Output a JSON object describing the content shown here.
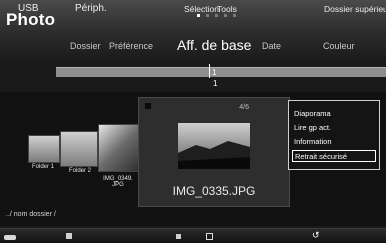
{
  "header": {
    "title": "Photo",
    "page_dots": 5,
    "active_dot": 0
  },
  "tabs": [
    {
      "label": "Dossier"
    },
    {
      "label": "Préférence"
    },
    {
      "label": "Aff. de base"
    },
    {
      "label": "Date"
    },
    {
      "label": "Couleur"
    }
  ],
  "active_tab": "Aff. de base",
  "timeline": {
    "marker_label_top": "1",
    "marker_label_bottom": "1"
  },
  "thumbnails": [
    {
      "caption": "Folder 1",
      "kind": "folder"
    },
    {
      "caption": "Folder 2",
      "kind": "folder"
    },
    {
      "caption": "IMG_0349.\nJPG",
      "kind": "photo"
    }
  ],
  "preview": {
    "count": "4/6",
    "filename": "IMG_0335.JPG"
  },
  "menu": {
    "items": [
      {
        "label": "Diaporama"
      },
      {
        "label": "Lire gp act."
      },
      {
        "label": "Information"
      },
      {
        "label": "Retrait sécurisé"
      }
    ],
    "selected": "Retrait sécurisé"
  },
  "path": "../ nom dossier /",
  "bottom": {
    "usb": "USB",
    "device": "Périph.",
    "select": "Sélection",
    "tools": "Tools",
    "back": "Dossier supérieur"
  }
}
